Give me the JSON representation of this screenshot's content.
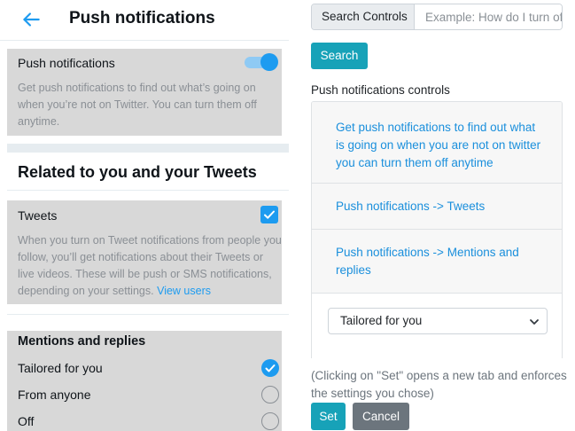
{
  "left": {
    "header": {
      "title": "Push notifications",
      "back_icon": "arrow-left-icon"
    },
    "push_row": {
      "label": "Push notifications",
      "description": "Get push notifications to find out what’s going on when you’re not on Twitter. You can turn them off anytime.",
      "toggle_on": true
    },
    "section_title": "Related to you and your Tweets",
    "tweets_row": {
      "label": "Tweets",
      "description": "When you turn on Tweet notifications from people you follow, you’ll get notifications about their Tweets or live videos. These will be push or SMS notifications, depending on your settings.",
      "link": "View users",
      "checked": true
    },
    "mentions": {
      "title": "Mentions and replies",
      "options": [
        {
          "label": "Tailored for you",
          "selected": true
        },
        {
          "label": "From anyone",
          "selected": false
        },
        {
          "label": "Off",
          "selected": false
        }
      ]
    }
  },
  "right": {
    "search": {
      "addon": "Search Controls",
      "placeholder": "Example: How do I turn off notifications?",
      "button": "Search"
    },
    "controls_heading": "Push notifications controls",
    "items": [
      "Get push notifications to find out what is going on when you are not on twitter you can turn them off anytime",
      "Push notifications -> Tweets",
      "Push notifications -> Mentions and replies"
    ],
    "select_value": "Tailored for you",
    "footer_note": "(Clicking on \"Set\" opens a new tab and enforces the settings you chose)",
    "set_button": "Set",
    "cancel_button": "Cancel"
  },
  "colors": {
    "accent": "#1d9bf0",
    "info": "#17a2b8",
    "secondary": "#6c757d",
    "block_gray": "#d8d8d8"
  }
}
